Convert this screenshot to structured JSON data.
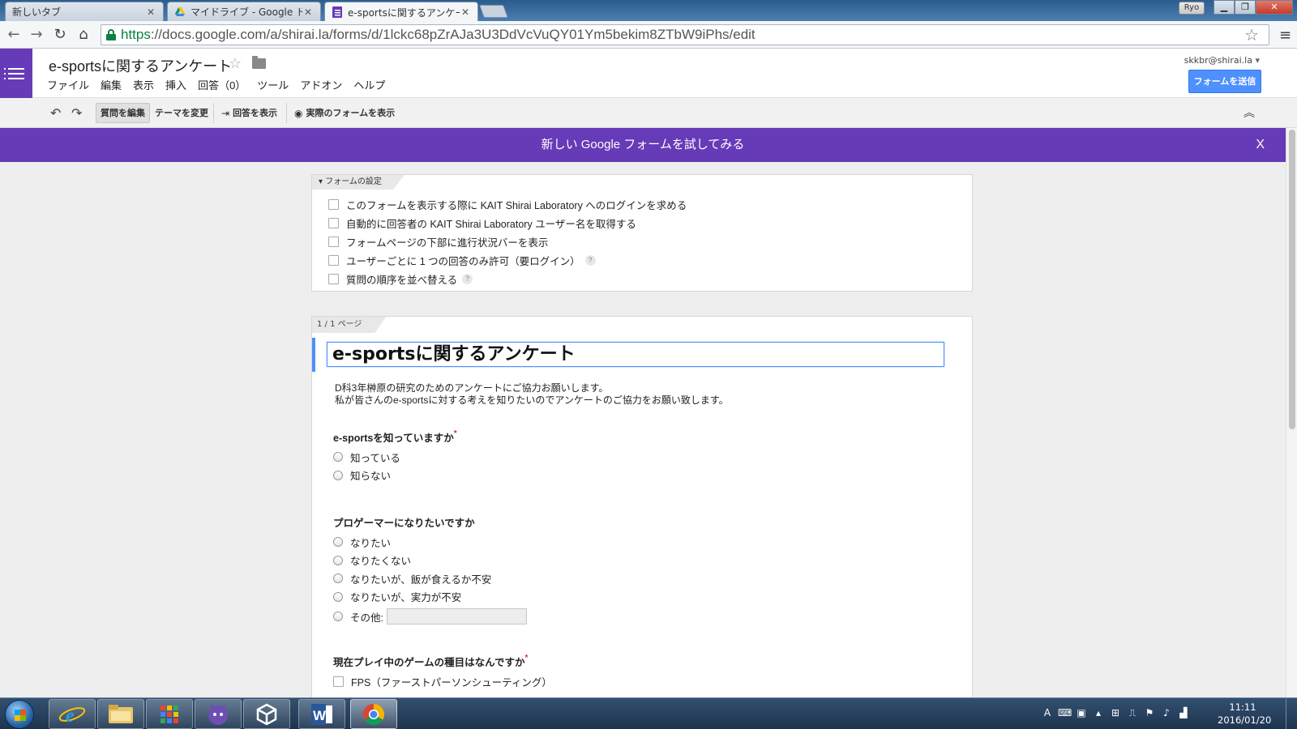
{
  "browser": {
    "tabs": [
      {
        "title": "新しいタブ",
        "active": false
      },
      {
        "title": "マイドライブ - Google ド",
        "active": false
      },
      {
        "title": "e-sportsに関するアンケー",
        "active": true
      }
    ],
    "profile_label": "Ryo",
    "address": {
      "scheme": "https",
      "rest": "://docs.google.com/a/shirai.la/forms/d/1lckc68pZrAJa3U3DdVcVuQY01Ym5bekim8ZTbW9iPhs/edit"
    }
  },
  "docs": {
    "title": "e-sportsに関するアンケート",
    "menu": [
      "ファイル",
      "編集",
      "表示",
      "挿入",
      "回答（0）",
      "ツール",
      "アドオン",
      "ヘルプ"
    ],
    "account": "skkbr@shirai.la",
    "send_button": "フォームを送信",
    "toolbar": {
      "edit_questions": "質問を編集",
      "change_theme": "テーマを変更",
      "view_responses": "回答を表示",
      "view_live_form": "実際のフォームを表示"
    },
    "banner": {
      "text": "新しい Google フォームを試してみる",
      "close": "X"
    }
  },
  "settings": {
    "header": "フォームの設定",
    "options": [
      {
        "label": "このフォームを表示する際に KAIT Shirai Laboratory へのログインを求める",
        "help": false
      },
      {
        "label": "自動的に回答者の KAIT Shirai Laboratory ユーザー名を取得する",
        "help": false
      },
      {
        "label": "フォームページの下部に進行状況バーを表示",
        "help": false
      },
      {
        "label": "ユーザーごとに 1 つの回答のみ許可（要ログイン）",
        "help": true
      },
      {
        "label": "質問の順序を並べ替える",
        "help": true
      }
    ]
  },
  "form": {
    "page_label": "1 / 1 ページ",
    "title": "e-sportsに関するアンケート",
    "description": [
      "D科3年榊原の研究のためのアンケートにご協力お願いします。",
      "私が皆さんのe-sportsに対する考えを知りたいのでアンケートのご協力をお願い致します。"
    ],
    "questions": [
      {
        "title": "e-sportsを知っていますか",
        "required": true,
        "type": "radio",
        "options": [
          "知っている",
          "知らない"
        ]
      },
      {
        "title": "プロゲーマーになりたいですか",
        "required": false,
        "type": "radio",
        "options": [
          "なりたい",
          "なりたくない",
          "なりたいが、飯が食えるか不安",
          "なりたいが、実力が不安"
        ],
        "other_label": "その他:"
      },
      {
        "title": "現在プレイ中のゲームの種目はなんですか",
        "required": true,
        "type": "checkbox",
        "options": [
          "FPS（ファーストパーソンシューティング）"
        ]
      }
    ]
  },
  "taskbar": {
    "clock_time": "11:11",
    "clock_date": "2016/01/20",
    "apps": [
      "internet-explorer",
      "file-explorer",
      "app-grid",
      "cat-app",
      "unity",
      "microsoft-word",
      "google-chrome"
    ]
  },
  "colors": {
    "forms_purple": "#673ab7",
    "send_blue": "#4d90fe",
    "secure_green": "#0b8043"
  }
}
